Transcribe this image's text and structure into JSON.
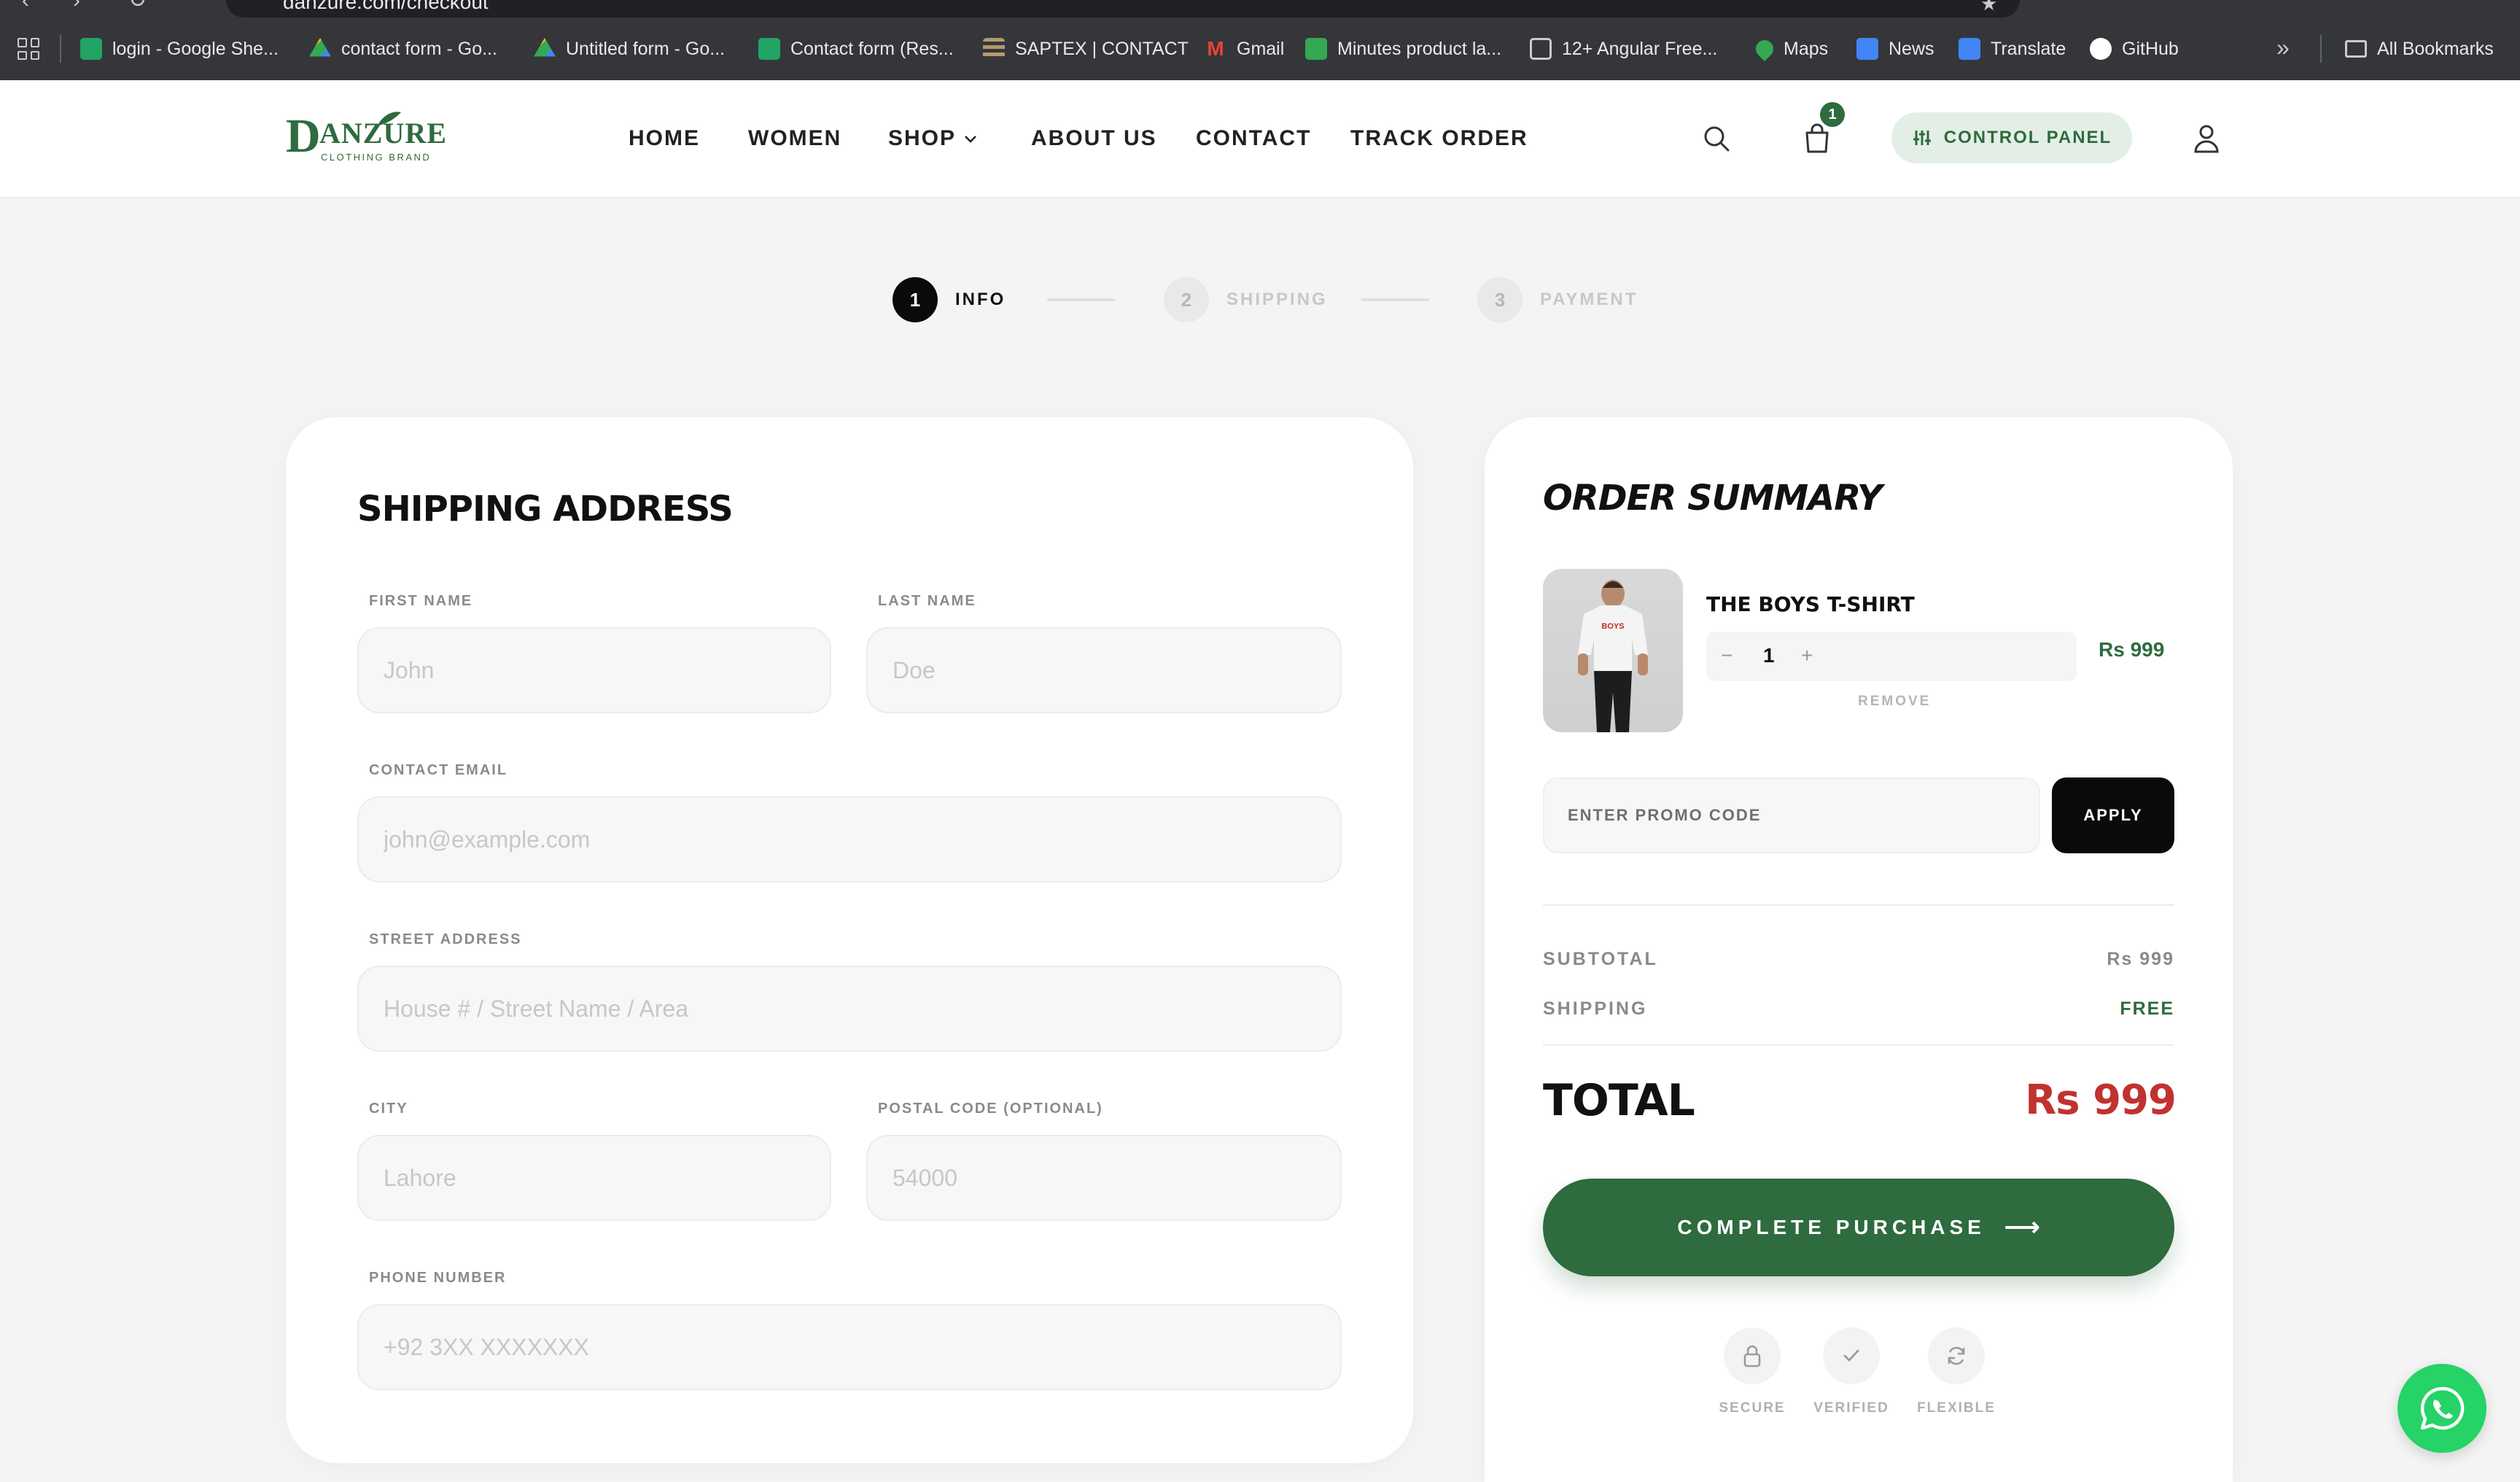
{
  "browser": {
    "url": "danzure.com/checkout",
    "bookmarks": [
      {
        "label": "login - Google She...",
        "icon": "google-sheets-icon",
        "color": "#21a464"
      },
      {
        "label": "contact form - Go...",
        "icon": "google-drive-icon",
        "color": "#4285f4"
      },
      {
        "label": "Untitled form - Go...",
        "icon": "google-drive-icon",
        "color": "#4285f4"
      },
      {
        "label": "Contact form (Res...",
        "icon": "google-sheets-icon",
        "color": "#21a464"
      },
      {
        "label": "SAPTEX | CONTACT",
        "icon": "saptex-icon",
        "color": "#b59a6b"
      },
      {
        "label": "Gmail",
        "icon": "gmail-icon",
        "color": "#ea4335"
      },
      {
        "label": "Minutes product la...",
        "icon": "minutes-icon",
        "color": "#34a853"
      },
      {
        "label": "12+ Angular Free...",
        "icon": "angular-template-icon",
        "color": "#9aa0a6"
      },
      {
        "label": "Maps",
        "icon": "maps-icon",
        "color": "#34a853"
      },
      {
        "label": "News",
        "icon": "news-icon",
        "color": "#4285f4"
      },
      {
        "label": "Translate",
        "icon": "translate-icon",
        "color": "#4285f4"
      },
      {
        "label": "GitHub",
        "icon": "github-icon",
        "color": "#ffffff"
      }
    ],
    "all_bookmarks": "All Bookmarks"
  },
  "header": {
    "logo_text": "DANZURE",
    "logo_tagline": "CLOTHING BRAND",
    "nav": [
      "HOME",
      "WOMEN",
      "SHOP",
      "ABOUT US",
      "CONTACT",
      "TRACK ORDER"
    ],
    "cart_count": "1",
    "control_panel": "CONTROL PANEL"
  },
  "stepper": {
    "steps": [
      {
        "number": "1",
        "label": "INFO",
        "active": true
      },
      {
        "number": "2",
        "label": "SHIPPING",
        "active": false
      },
      {
        "number": "3",
        "label": "PAYMENT",
        "active": false
      }
    ]
  },
  "shipping": {
    "title": "SHIPPING ADDRESS",
    "first_name": {
      "label": "FIRST NAME",
      "placeholder": "John",
      "value": ""
    },
    "last_name": {
      "label": "LAST NAME",
      "placeholder": "Doe",
      "value": ""
    },
    "email": {
      "label": "CONTACT EMAIL",
      "placeholder": "john@example.com",
      "value": ""
    },
    "street": {
      "label": "STREET ADDRESS",
      "placeholder": "House # / Street Name / Area",
      "value": ""
    },
    "city": {
      "label": "CITY",
      "placeholder": "Lahore",
      "value": ""
    },
    "postal": {
      "label": "POSTAL CODE (OPTIONAL)",
      "placeholder": "54000",
      "value": ""
    },
    "phone": {
      "label": "PHONE NUMBER",
      "placeholder": "+92 3XX XXXXXXX",
      "value": ""
    }
  },
  "summary": {
    "title": "ORDER SUMMARY",
    "item": {
      "name": "THE BOYS T-SHIRT",
      "qty": "1",
      "minus": "−",
      "plus": "+",
      "price": "Rs 999",
      "remove": "REMOVE",
      "shirt_print": "BOYS"
    },
    "promo_placeholder": "ENTER PROMO CODE",
    "apply": "APPLY",
    "subtotal_label": "SUBTOTAL",
    "subtotal_value": "Rs 999",
    "shipping_label": "SHIPPING",
    "shipping_value": "FREE",
    "total_label": "TOTAL",
    "total_value": "Rs 999",
    "complete": "COMPLETE PURCHASE",
    "arrow": "⟶",
    "trust": [
      {
        "label": "SECURE",
        "icon": "lock-icon"
      },
      {
        "label": "VERIFIED",
        "icon": "check-icon"
      },
      {
        "label": "FLEXIBLE",
        "icon": "refresh-icon"
      }
    ]
  },
  "colors": {
    "brand_green": "#2e6b3e",
    "price_red": "#c0322f",
    "whatsapp": "#25d366"
  }
}
